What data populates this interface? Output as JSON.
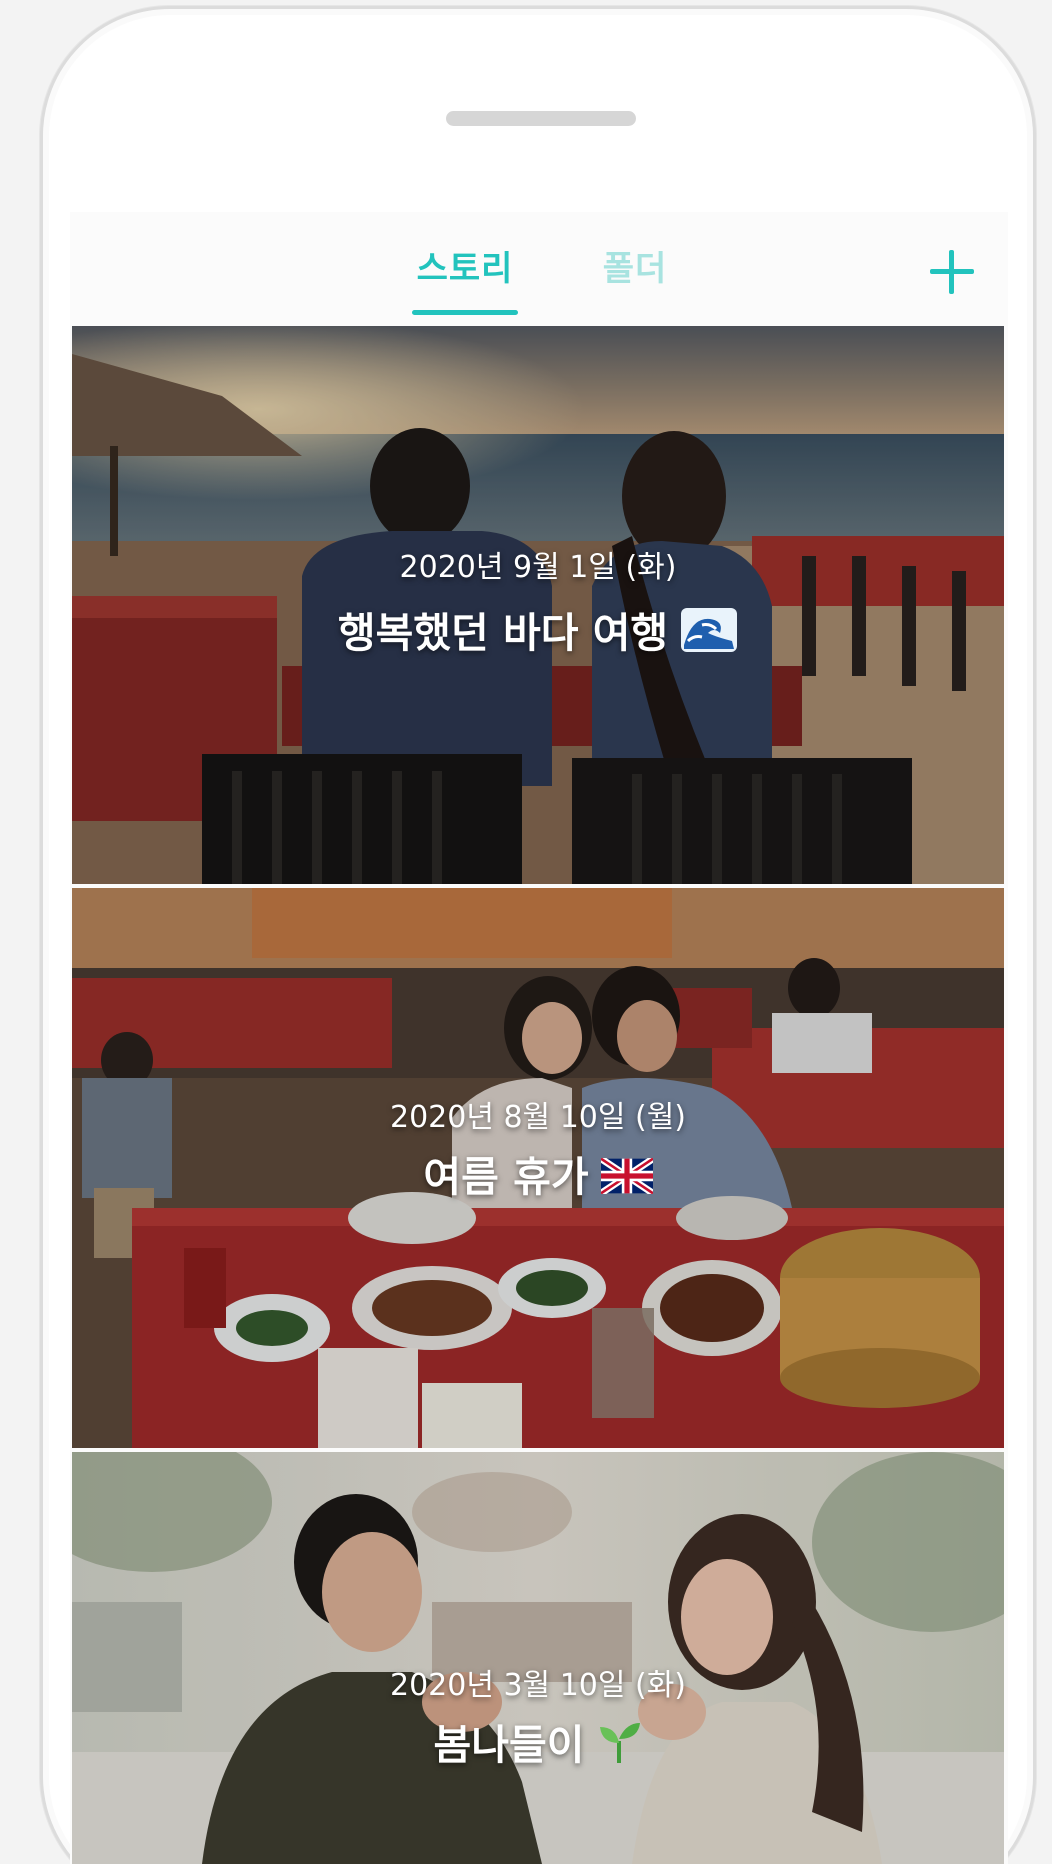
{
  "tabs": [
    {
      "label": "스토리",
      "active": true
    },
    {
      "label": "폴더",
      "active": false
    }
  ],
  "add_button_icon": "plus-icon",
  "colors": {
    "accent": "#22c3bd",
    "accent_inactive": "#a8e3e0"
  },
  "stories": [
    {
      "date": "2020년 9월 1일 (화)",
      "title": "행복했던 바다 여행",
      "emoji_icon": "wave-icon"
    },
    {
      "date": "2020년 8월 10일 (월)",
      "title": "여름 휴가",
      "emoji_icon": "uk-flag-icon"
    },
    {
      "date": "2020년 3월 10일 (화)",
      "title": "봄나들이",
      "emoji_icon": "seedling-icon"
    }
  ]
}
